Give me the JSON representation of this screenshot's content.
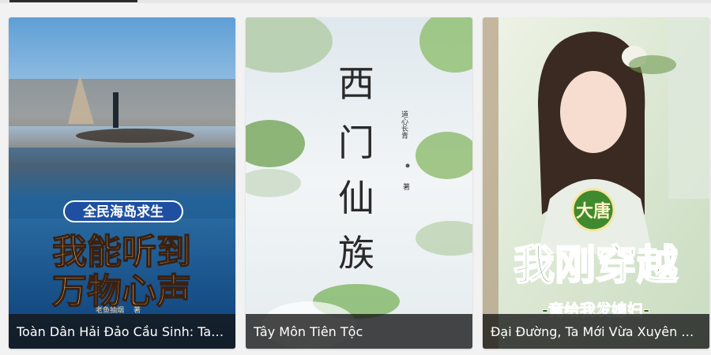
{
  "books": [
    {
      "title": "Toàn Dân Hải Đảo Cầu Sinh: Ta Có Thể Nghe Được Tiếng Lòng Vạn Vật",
      "cover_banner": "全民海岛求生",
      "cover_title_line1": "我能听到",
      "cover_title_line2": "万物心声",
      "cover_author": "老鱼抽烟",
      "cover_author_suffix": "著"
    },
    {
      "title": "Tây Môn Tiên Tộc",
      "cover_title_chars": [
        "西",
        "门",
        "仙",
        "族"
      ],
      "cover_author": "道心长青",
      "cover_author_suffix": "著"
    },
    {
      "title": "Đại Đường, Ta Mới Vừa Xuyên Qua",
      "cover_badge": "大唐",
      "cover_title": "我刚穿越",
      "cover_subtitle": "-竟给我发媳妇-"
    }
  ]
}
